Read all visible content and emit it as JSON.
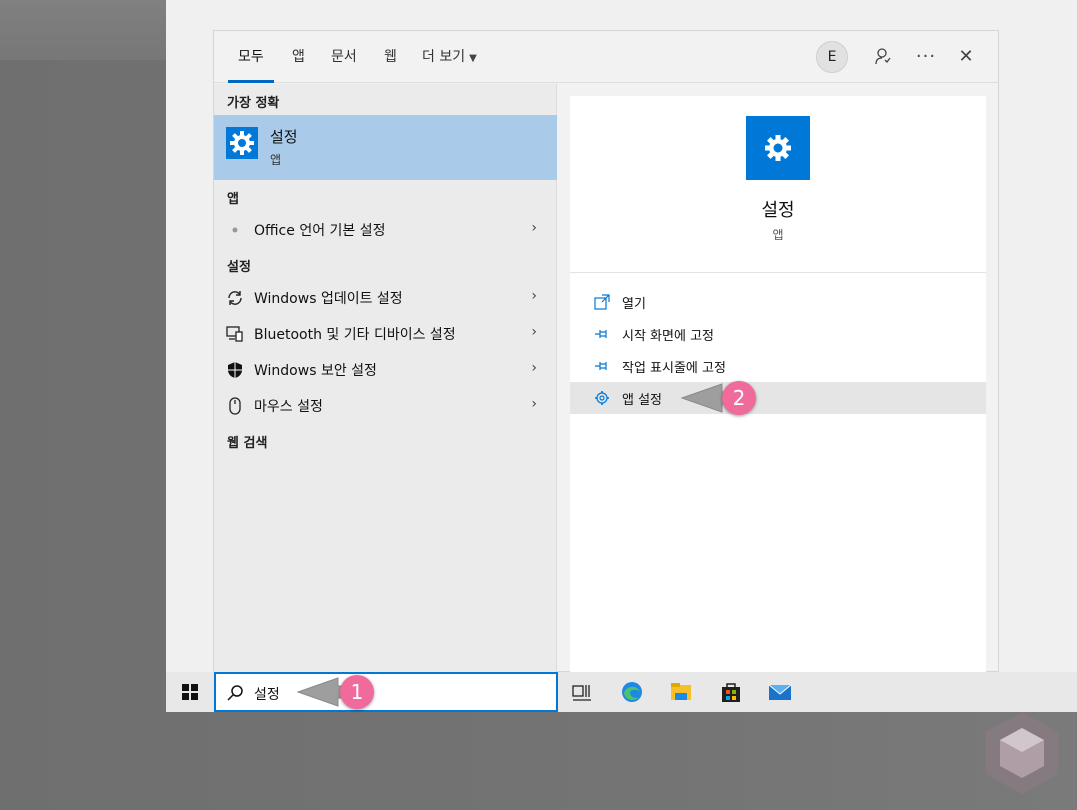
{
  "tabs": [
    {
      "label": "모두",
      "active": true
    },
    {
      "label": "앱"
    },
    {
      "label": "문서"
    },
    {
      "label": "웹"
    },
    {
      "label": "더 보기"
    }
  ],
  "account": {
    "initial": "E"
  },
  "top_icons": [
    "feedback-icon",
    "more-icon",
    "close-icon"
  ],
  "more_glyph": "···",
  "close_glyph": "✕",
  "left": {
    "best_match_header": "가장 정확",
    "best_match": {
      "title": "설정",
      "subtitle": "앱",
      "icon": "gear-icon"
    },
    "apps_header": "앱",
    "apps": [
      {
        "label": "Office 언어 기본 설정",
        "icon": "office-icon"
      }
    ],
    "settings_header": "설정",
    "settings": [
      {
        "label": "Windows 업데이트 설정",
        "icon": "refresh-icon"
      },
      {
        "label": "Bluetooth 및 기타 디바이스 설정",
        "icon": "devices-icon"
      },
      {
        "label": "Windows 보안 설정",
        "icon": "shield-icon"
      },
      {
        "label": "마우스 설정",
        "icon": "mouse-icon"
      }
    ],
    "web_header": "웹 검색",
    "chevron": "›"
  },
  "detail": {
    "title": "설정",
    "subtitle": "앱",
    "icon": "gear-icon",
    "actions": [
      {
        "label": "열기",
        "icon": "open-icon"
      },
      {
        "label": "시작 화면에 고정",
        "icon": "pin-icon"
      },
      {
        "label": "작업 표시줄에 고정",
        "icon": "pin-icon"
      },
      {
        "label": "앱 설정",
        "icon": "gear-icon"
      }
    ]
  },
  "taskbar": {
    "search_value": "설정",
    "icons": [
      "task-view-icon",
      "edge-icon",
      "file-explorer-icon",
      "store-icon",
      "mail-icon"
    ]
  },
  "callouts": [
    "1",
    "2"
  ],
  "colors": {
    "accent": "#0078d7",
    "selection": "#a9cbe9",
    "badge": "#f06a9b"
  }
}
